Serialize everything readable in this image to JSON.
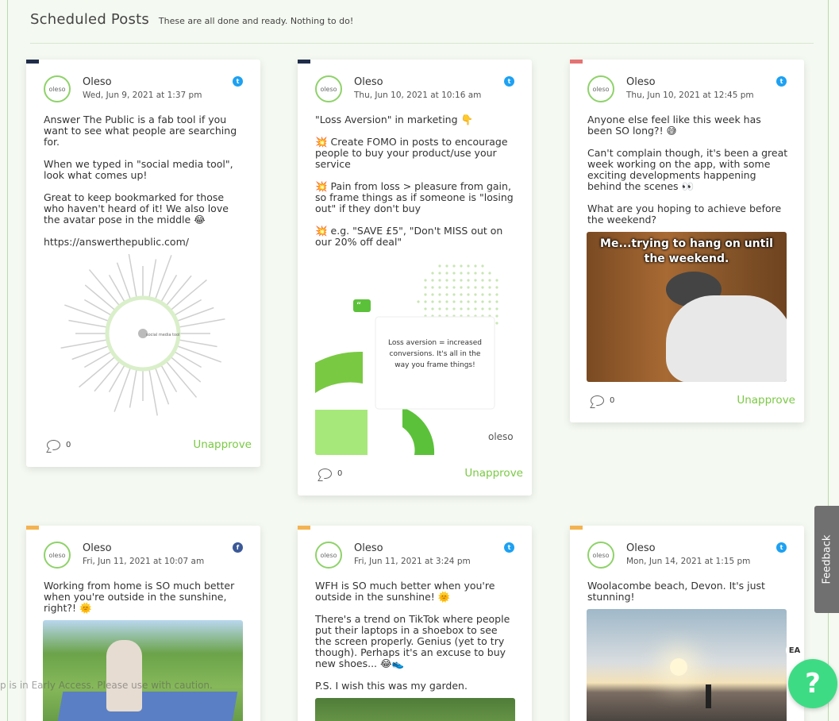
{
  "header": {
    "title": "Scheduled Posts",
    "subtitle": "These are all done and ready. Nothing to do!"
  },
  "colors": {
    "accent": "#7ac943",
    "twitter": "#1da1f2",
    "facebook": "#3b5998",
    "flag_navy": "#1f2d4a",
    "flag_red": "#e57373",
    "flag_orange": "#f4b350"
  },
  "cards": [
    {
      "name": "Oleso",
      "date": "Wed, Jun 9, 2021 at 1:37 pm",
      "network": "twitter-icon",
      "paragraphs": [
        "Answer The Public is a fab tool if you want to see what people are searching for.",
        "When we typed in \"social media tool\", look what comes up!",
        "Great to keep bookmarked for those who haven't heard of it! We also love the avatar pose in the middle 😂",
        "https://answerthepublic.com/"
      ],
      "media_label": "social media tool",
      "comments": "0",
      "action": "Unapprove"
    },
    {
      "name": "Oleso",
      "date": "Thu, Jun 10, 2021 at 10:16 am",
      "network": "twitter-icon",
      "paragraphs": [
        "\"Loss Aversion\" in marketing 👇",
        "💥 Create FOMO in posts to encourage people to buy your product/use your service",
        "💥 Pain from loss > pleasure from gain, so frame things as if someone is \"losing out\" if they don't buy",
        "💥 e.g. \"SAVE £5\", \"Don't MISS out on our 20% off deal\""
      ],
      "media_quote": "Loss aversion = increased conversions. It's all in the way you frame things!",
      "media_brand": "oleso",
      "comments": "0",
      "action": "Unapprove"
    },
    {
      "name": "Oleso",
      "date": "Thu, Jun 10, 2021 at 12:45 pm",
      "network": "twitter-icon",
      "paragraphs": [
        "Anyone else feel like this week has been SO long?! 😅",
        "Can't complain though, it's been a great week working on the app, with some exciting developments happening behind the scenes 👀",
        "What are you hoping to achieve before the weekend?"
      ],
      "media_caption": "Me...trying to hang on until the weekend.",
      "comments": "0",
      "action": "Unapprove"
    },
    {
      "name": "Oleso",
      "date": "Fri, Jun 11, 2021 at 10:07 am",
      "network": "facebook-icon",
      "paragraphs": [
        "Working from home is SO much better when you're outside in the sunshine, right?! 🌞"
      ]
    },
    {
      "name": "Oleso",
      "date": "Fri, Jun 11, 2021 at 3:24 pm",
      "network": "twitter-icon",
      "paragraphs": [
        "WFH is SO much better when you're outside in the sunshine! 🌞",
        "There's a trend on TikTok where people put their laptops in a shoebox to see the screen properly. Genius (yet to try though). Perhaps it's an excuse to buy new shoes... 😂👟",
        "P.S. I wish this was my garden."
      ]
    },
    {
      "name": "Oleso",
      "date": "Mon, Jun 14, 2021 at 1:15 pm",
      "network": "twitter-icon",
      "paragraphs": [
        "Woolacombe beach, Devon. It's just stunning!"
      ]
    }
  ],
  "avatar_text": "oleso",
  "feedback_label": "Feedback",
  "ea_badge": "EA",
  "help_label": "?",
  "early_access_text": "p is in Early Access. Please use with caution."
}
